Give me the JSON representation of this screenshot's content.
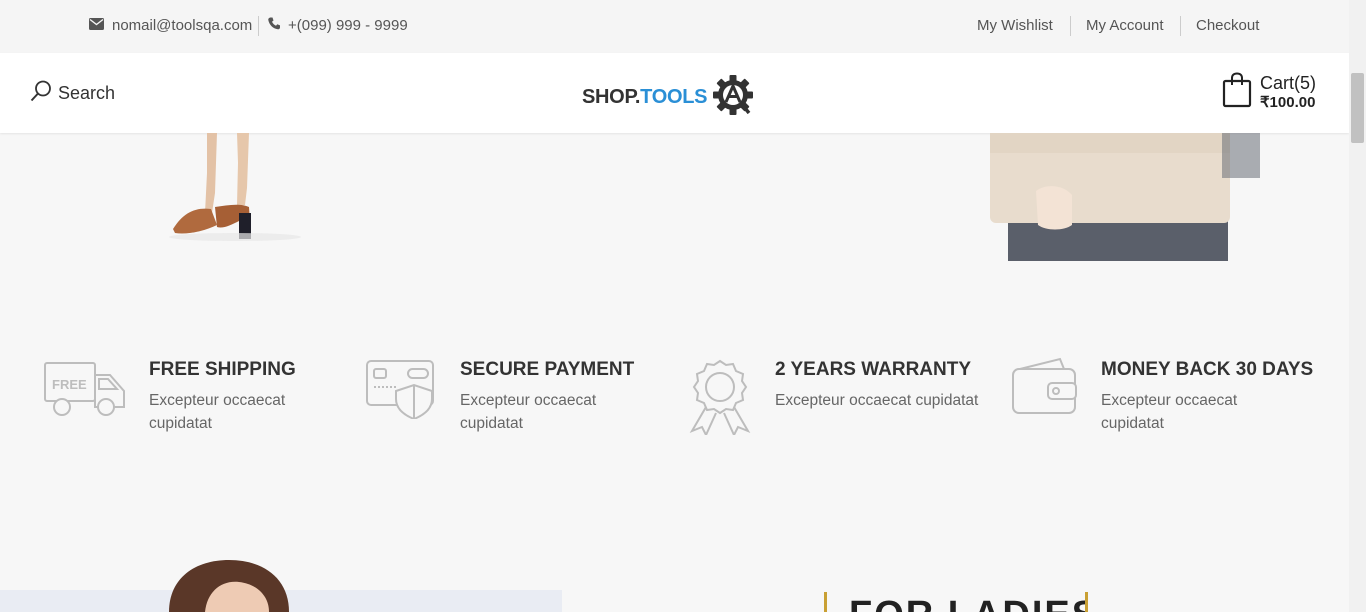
{
  "topbar": {
    "email": "nomail@toolsqa.com",
    "phone": "+(099) 999 - 9999",
    "links": [
      "My Wishlist",
      "My Account",
      "Checkout"
    ]
  },
  "header": {
    "search_label": "Search",
    "logo": {
      "shop": "SHOP.",
      "tools": "TOOLS"
    },
    "cart_label": "Cart(5)",
    "cart_price": "₹100.00"
  },
  "features": [
    {
      "icon": "truck-icon",
      "badge": "FREE",
      "title": "FREE SHIPPING",
      "text": "Excepteur occaecat cupidatat"
    },
    {
      "icon": "card-shield-icon",
      "title": "SECURE PAYMENT",
      "text": "Excepteur occaecat cupidatat"
    },
    {
      "icon": "award-ribbon-icon",
      "title": "2 YEARS WARRANTY",
      "text": "Excepteur occaecat cupidatat"
    },
    {
      "icon": "wallet-icon",
      "title": "MONEY BACK 30 DAYS",
      "text": "Excepteur occaecat cupidatat"
    }
  ],
  "promo": {
    "title": "FOR LADIES"
  },
  "colors": {
    "accent": "#2a8fd6",
    "gold": "#c9a034",
    "icon_gray": "#bdbdbd"
  }
}
